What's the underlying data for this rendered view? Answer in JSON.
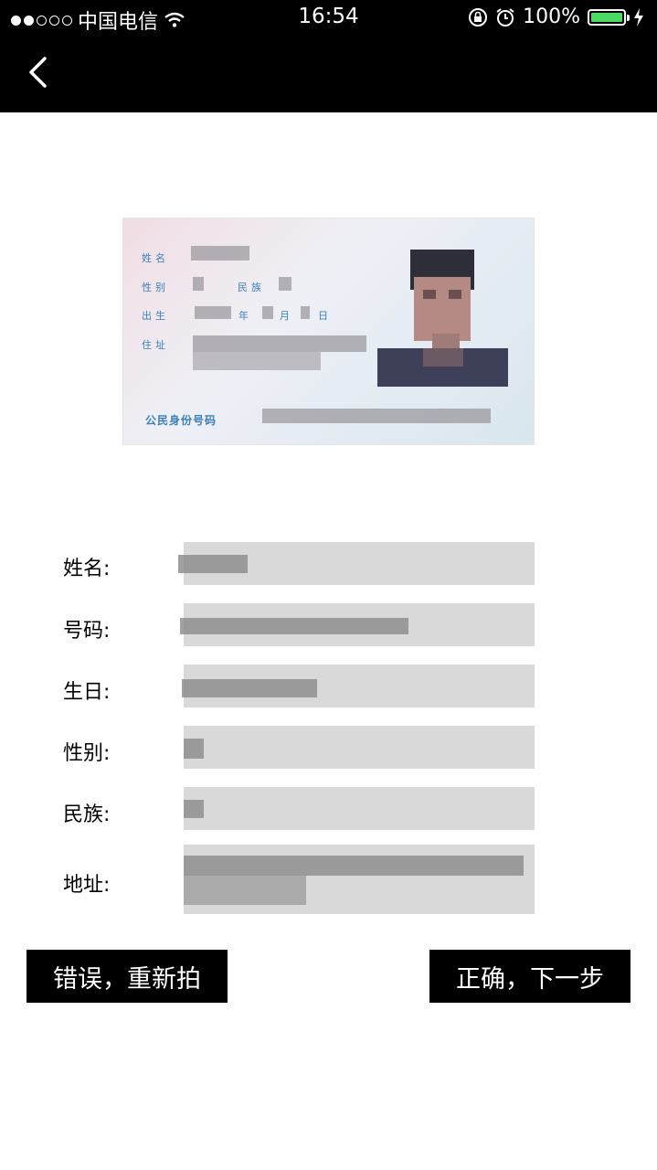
{
  "status_bar": {
    "carrier": "中国电信",
    "time": "16:54",
    "battery_percent": "100%",
    "battery_level": 1.0,
    "icons": [
      "signal-dots-icon",
      "wifi-icon",
      "orientation-lock-icon",
      "alarm-icon",
      "battery-icon",
      "charging-icon"
    ]
  },
  "nav": {
    "back_icon": "chevron-left-icon"
  },
  "id_card": {
    "labels": {
      "name": "姓名",
      "gender": "性别",
      "ethnicity": "民族",
      "birth": "出生",
      "year": "年",
      "month": "月",
      "day": "日",
      "address": "住址",
      "id_number": "公民身份号码"
    }
  },
  "form": {
    "fields": [
      {
        "label": "姓名:"
      },
      {
        "label": "号码:"
      },
      {
        "label": "生日:"
      },
      {
        "label": "性别:"
      },
      {
        "label": "民族:"
      },
      {
        "label": "地址:"
      }
    ]
  },
  "actions": {
    "retake_label": "错误，重新拍",
    "confirm_label": "正确，下一步"
  },
  "colors": {
    "nav_bg": "#000000",
    "field_bg": "#d9d9d9",
    "button_bg": "#000000",
    "battery_green": "#4cd964",
    "card_label_blue": "#3c7fb4"
  }
}
